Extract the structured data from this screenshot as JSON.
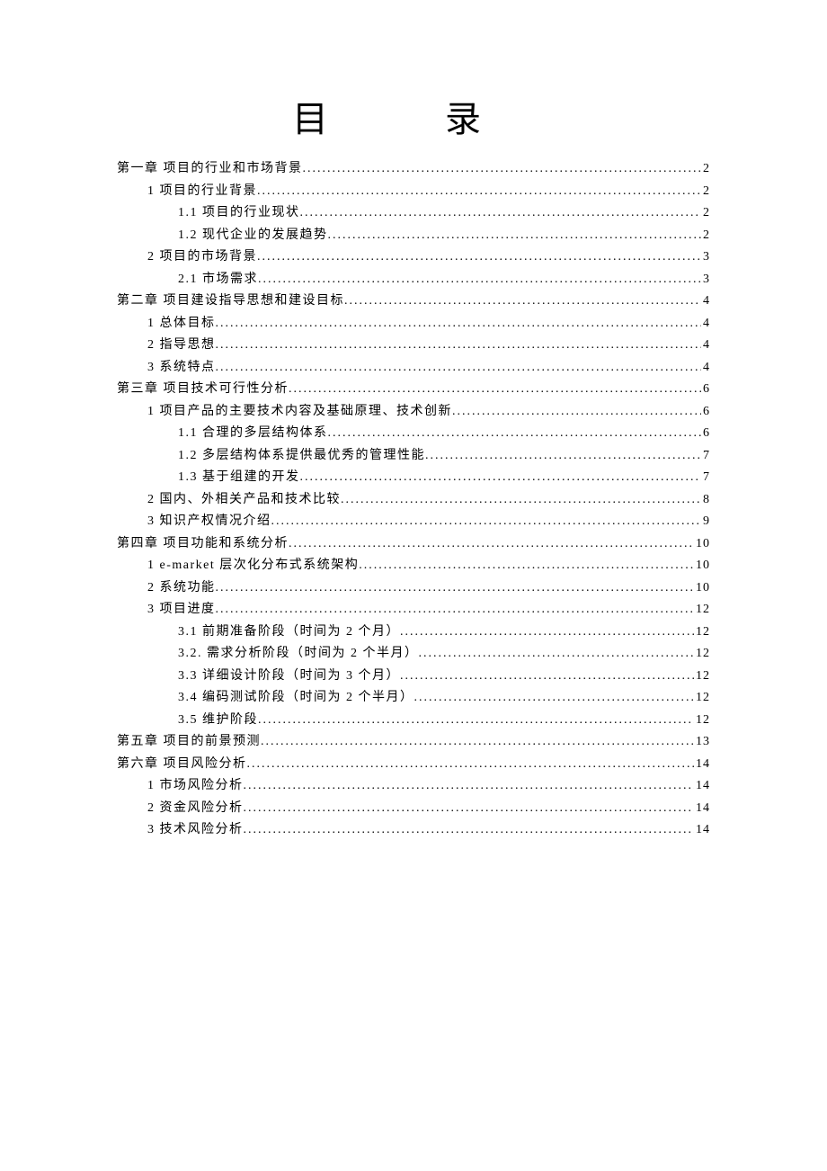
{
  "title": "目  录",
  "entries": [
    {
      "level": 0,
      "label": "第一章 项目的行业和市场背景",
      "page": "2"
    },
    {
      "level": 1,
      "label": "1 项目的行业背景",
      "page": "2"
    },
    {
      "level": 2,
      "label": "1.1 项目的行业现状",
      "page": "2"
    },
    {
      "level": 2,
      "label": "1.2 现代企业的发展趋势",
      "page": "2"
    },
    {
      "level": 1,
      "label": "2 项目的市场背景",
      "page": "3"
    },
    {
      "level": 2,
      "label": "2.1 市场需求",
      "page": "3"
    },
    {
      "level": 0,
      "label": "第二章 项目建设指导思想和建设目标",
      "page": "4"
    },
    {
      "level": 1,
      "label": "1 总体目标",
      "page": "4"
    },
    {
      "level": 1,
      "label": "2 指导思想",
      "page": "4"
    },
    {
      "level": 1,
      "label": "3 系统特点",
      "page": "4"
    },
    {
      "level": 0,
      "label": "第三章 项目技术可行性分析",
      "page": "6"
    },
    {
      "level": 1,
      "label": "1 项目产品的主要技术内容及基础原理、技术创新",
      "page": "6"
    },
    {
      "level": 2,
      "label": "1.1 合理的多层结构体系",
      "page": "6"
    },
    {
      "level": 2,
      "label": "1.2 多层结构体系提供最优秀的管理性能",
      "page": "7"
    },
    {
      "level": 2,
      "label": "1.3 基于组建的开发",
      "page": "7"
    },
    {
      "level": 1,
      "label": "2 国内、外相关产品和技术比较",
      "page": "8"
    },
    {
      "level": 1,
      "label": "3 知识产权情况介绍",
      "page": "9"
    },
    {
      "level": 0,
      "label": "第四章 项目功能和系统分析",
      "page": "10"
    },
    {
      "level": 1,
      "label": "1 e-market 层次化分布式系统架构",
      "page": "10"
    },
    {
      "level": 1,
      "label": "2 系统功能",
      "page": "10"
    },
    {
      "level": 1,
      "label": "3 项目进度",
      "page": "12"
    },
    {
      "level": 2,
      "label": "3.1 前期准备阶段（时间为 2 个月）",
      "page": "12"
    },
    {
      "level": 2,
      "label": "3.2. 需求分析阶段（时间为 2 个半月）",
      "page": "12"
    },
    {
      "level": 2,
      "label": "3.3 详细设计阶段（时间为 3 个月）",
      "page": "12"
    },
    {
      "level": 2,
      "label": "3.4 编码测试阶段（时间为 2 个半月）",
      "page": "12"
    },
    {
      "level": 2,
      "label": "3.5 维护阶段",
      "page": "12"
    },
    {
      "level": 0,
      "label": "第五章 项目的前景预测",
      "page": "13"
    },
    {
      "level": 0,
      "label": "第六章 项目风险分析",
      "page": "14"
    },
    {
      "level": 1,
      "label": "1 市场风险分析",
      "page": "14"
    },
    {
      "level": 1,
      "label": "2 资金风险分析",
      "page": "14"
    },
    {
      "level": 1,
      "label": "3 技术风险分析",
      "page": "14"
    }
  ]
}
